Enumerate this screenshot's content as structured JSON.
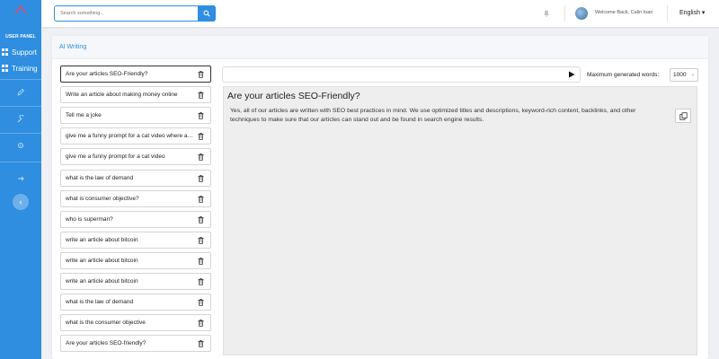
{
  "sidebar": {
    "panel_title": "USER PANEL",
    "items": [
      {
        "label": "Support",
        "icon": "grid-icon"
      },
      {
        "label": "Training",
        "icon": "grid-icon"
      }
    ],
    "icons": [
      "pencil-icon",
      "wrench-icon",
      "gear-icon",
      "logout-icon"
    ],
    "collapse_glyph": "‹"
  },
  "topbar": {
    "search_placeholder": "Search something...",
    "welcome": "Welcome Back, Calin Ioan",
    "language": "English ▾"
  },
  "card": {
    "title": "AI Writing"
  },
  "history": [
    "Are your articles SEO-Friendly?",
    "Write an article about making money online",
    "Tell me a joke",
    "give me a funny prompt for a cat video where a cat is",
    "give me a funny prompt for a cat video",
    "what is the law of demand",
    "what is consumer objective?",
    "who is superman?",
    "write an article about bitcoin",
    "write an article about bitcoin",
    "write an article about bitcoin",
    "what is the law of demand",
    "what is the consumer objective",
    "Are your articles SEO-friendly?"
  ],
  "prompt": {
    "value": "",
    "max_words_label": "Maximum generated words:",
    "max_words_value": "1000"
  },
  "output": {
    "title": "Are your articles SEO-Friendly?",
    "body": "Yes, all of our articles are written with SEO best practices in mind. We use optimized titles and descriptions, keyword-rich content, backlinks, and other techniques to make sure that our articles can stand out and be found in search engine results."
  },
  "colors": {
    "accent": "#2f8ee0",
    "background": "#eef0f4"
  }
}
